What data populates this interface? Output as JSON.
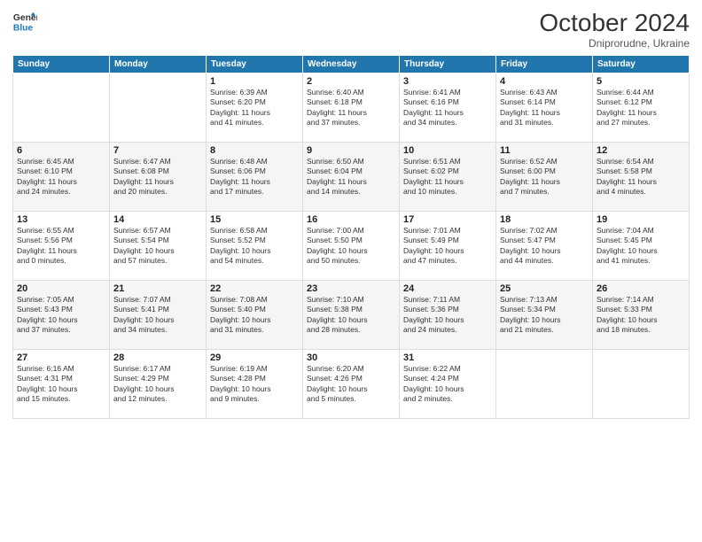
{
  "header": {
    "logo": {
      "line1": "General",
      "line2": "Blue"
    },
    "title": "October 2024",
    "subtitle": "Dniprorudne, Ukraine"
  },
  "weekdays": [
    "Sunday",
    "Monday",
    "Tuesday",
    "Wednesday",
    "Thursday",
    "Friday",
    "Saturday"
  ],
  "weeks": [
    [
      {
        "day": "",
        "info": ""
      },
      {
        "day": "",
        "info": ""
      },
      {
        "day": "1",
        "info": "Sunrise: 6:39 AM\nSunset: 6:20 PM\nDaylight: 11 hours\nand 41 minutes."
      },
      {
        "day": "2",
        "info": "Sunrise: 6:40 AM\nSunset: 6:18 PM\nDaylight: 11 hours\nand 37 minutes."
      },
      {
        "day": "3",
        "info": "Sunrise: 6:41 AM\nSunset: 6:16 PM\nDaylight: 11 hours\nand 34 minutes."
      },
      {
        "day": "4",
        "info": "Sunrise: 6:43 AM\nSunset: 6:14 PM\nDaylight: 11 hours\nand 31 minutes."
      },
      {
        "day": "5",
        "info": "Sunrise: 6:44 AM\nSunset: 6:12 PM\nDaylight: 11 hours\nand 27 minutes."
      }
    ],
    [
      {
        "day": "6",
        "info": "Sunrise: 6:45 AM\nSunset: 6:10 PM\nDaylight: 11 hours\nand 24 minutes."
      },
      {
        "day": "7",
        "info": "Sunrise: 6:47 AM\nSunset: 6:08 PM\nDaylight: 11 hours\nand 20 minutes."
      },
      {
        "day": "8",
        "info": "Sunrise: 6:48 AM\nSunset: 6:06 PM\nDaylight: 11 hours\nand 17 minutes."
      },
      {
        "day": "9",
        "info": "Sunrise: 6:50 AM\nSunset: 6:04 PM\nDaylight: 11 hours\nand 14 minutes."
      },
      {
        "day": "10",
        "info": "Sunrise: 6:51 AM\nSunset: 6:02 PM\nDaylight: 11 hours\nand 10 minutes."
      },
      {
        "day": "11",
        "info": "Sunrise: 6:52 AM\nSunset: 6:00 PM\nDaylight: 11 hours\nand 7 minutes."
      },
      {
        "day": "12",
        "info": "Sunrise: 6:54 AM\nSunset: 5:58 PM\nDaylight: 11 hours\nand 4 minutes."
      }
    ],
    [
      {
        "day": "13",
        "info": "Sunrise: 6:55 AM\nSunset: 5:56 PM\nDaylight: 11 hours\nand 0 minutes."
      },
      {
        "day": "14",
        "info": "Sunrise: 6:57 AM\nSunset: 5:54 PM\nDaylight: 10 hours\nand 57 minutes."
      },
      {
        "day": "15",
        "info": "Sunrise: 6:58 AM\nSunset: 5:52 PM\nDaylight: 10 hours\nand 54 minutes."
      },
      {
        "day": "16",
        "info": "Sunrise: 7:00 AM\nSunset: 5:50 PM\nDaylight: 10 hours\nand 50 minutes."
      },
      {
        "day": "17",
        "info": "Sunrise: 7:01 AM\nSunset: 5:49 PM\nDaylight: 10 hours\nand 47 minutes."
      },
      {
        "day": "18",
        "info": "Sunrise: 7:02 AM\nSunset: 5:47 PM\nDaylight: 10 hours\nand 44 minutes."
      },
      {
        "day": "19",
        "info": "Sunrise: 7:04 AM\nSunset: 5:45 PM\nDaylight: 10 hours\nand 41 minutes."
      }
    ],
    [
      {
        "day": "20",
        "info": "Sunrise: 7:05 AM\nSunset: 5:43 PM\nDaylight: 10 hours\nand 37 minutes."
      },
      {
        "day": "21",
        "info": "Sunrise: 7:07 AM\nSunset: 5:41 PM\nDaylight: 10 hours\nand 34 minutes."
      },
      {
        "day": "22",
        "info": "Sunrise: 7:08 AM\nSunset: 5:40 PM\nDaylight: 10 hours\nand 31 minutes."
      },
      {
        "day": "23",
        "info": "Sunrise: 7:10 AM\nSunset: 5:38 PM\nDaylight: 10 hours\nand 28 minutes."
      },
      {
        "day": "24",
        "info": "Sunrise: 7:11 AM\nSunset: 5:36 PM\nDaylight: 10 hours\nand 24 minutes."
      },
      {
        "day": "25",
        "info": "Sunrise: 7:13 AM\nSunset: 5:34 PM\nDaylight: 10 hours\nand 21 minutes."
      },
      {
        "day": "26",
        "info": "Sunrise: 7:14 AM\nSunset: 5:33 PM\nDaylight: 10 hours\nand 18 minutes."
      }
    ],
    [
      {
        "day": "27",
        "info": "Sunrise: 6:16 AM\nSunset: 4:31 PM\nDaylight: 10 hours\nand 15 minutes."
      },
      {
        "day": "28",
        "info": "Sunrise: 6:17 AM\nSunset: 4:29 PM\nDaylight: 10 hours\nand 12 minutes."
      },
      {
        "day": "29",
        "info": "Sunrise: 6:19 AM\nSunset: 4:28 PM\nDaylight: 10 hours\nand 9 minutes."
      },
      {
        "day": "30",
        "info": "Sunrise: 6:20 AM\nSunset: 4:26 PM\nDaylight: 10 hours\nand 5 minutes."
      },
      {
        "day": "31",
        "info": "Sunrise: 6:22 AM\nSunset: 4:24 PM\nDaylight: 10 hours\nand 2 minutes."
      },
      {
        "day": "",
        "info": ""
      },
      {
        "day": "",
        "info": ""
      }
    ]
  ]
}
